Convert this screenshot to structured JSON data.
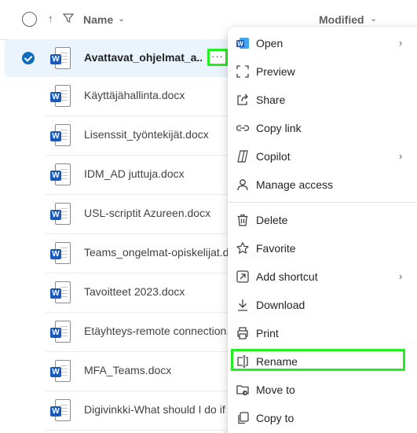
{
  "header": {
    "name_label": "Name",
    "modified_label": "Modified",
    "sort_arrow": "↑",
    "chevron": "⌄"
  },
  "files": [
    {
      "name": "Avattavat_ohjelmat_a...",
      "selected": true
    },
    {
      "name": "Käyttäjähallinta.docx"
    },
    {
      "name": "Lisenssit_työntekijät.docx"
    },
    {
      "name": "IDM_AD juttuja.docx"
    },
    {
      "name": "USL-scriptit Azureen.docx"
    },
    {
      "name": "Teams_ongelmat-opiskelijat.d"
    },
    {
      "name": "Tavoitteet 2023.docx"
    },
    {
      "name": "Etäyhteys-remote connection."
    },
    {
      "name": "MFA_Teams.docx"
    },
    {
      "name": "Digivinkki-What should I do if"
    }
  ],
  "file_icon_badge": "W",
  "more_button": "···",
  "menu": {
    "open": "Open",
    "preview": "Preview",
    "share": "Share",
    "copy_link": "Copy link",
    "copilot": "Copilot",
    "manage_access": "Manage access",
    "delete": "Delete",
    "favorite": "Favorite",
    "add_shortcut": "Add shortcut",
    "download": "Download",
    "print": "Print",
    "rename": "Rename",
    "move_to": "Move to",
    "copy_to": "Copy to",
    "submenu_chevron": "›"
  },
  "colors": {
    "accent": "#0f6cbd",
    "word_blue": "#185abd",
    "highlight": "#22ee22",
    "selected_row": "#ebf3fc"
  }
}
